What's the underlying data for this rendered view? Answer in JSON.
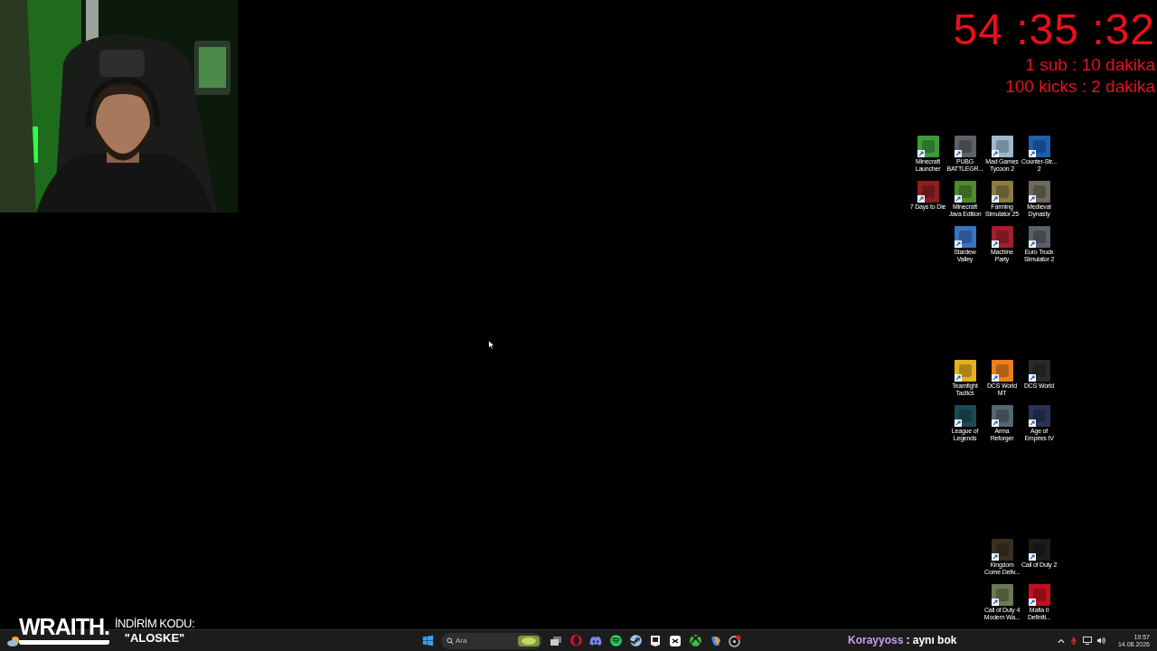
{
  "timer": {
    "time": "54 :35 :32",
    "rules": [
      "1 sub : 10 dakika",
      "100 kicks : 2 dakika"
    ]
  },
  "desktop_icon_groups": [
    {
      "rows": [
        [
          {
            "label": "Minecraft\nLauncher",
            "color": "#3c9b3a"
          },
          {
            "label": "PUBG\nBATTLEGR...",
            "color": "#5e6266"
          },
          {
            "label": "Mad Games\nTycoon 2",
            "color": "#9fb9cc"
          },
          {
            "label": "Counter-Str...\n2",
            "color": "#1f5fb0"
          }
        ],
        [
          {
            "label": "7 Days to Die",
            "color": "#8c1e1e"
          },
          {
            "label": "Minecraft\nJava Edition",
            "color": "#4f8a2c"
          },
          {
            "label": "Farming\nSimulator 25",
            "color": "#8a7b44"
          },
          {
            "label": "Medieval\nDynasty",
            "color": "#6d6a5c"
          }
        ],
        [
          "",
          {
            "label": "Stardew\nValley",
            "color": "#3a72c4"
          },
          {
            "label": "Machine\nParty",
            "color": "#a2202e"
          },
          {
            "label": "Euro Truck\nSimulator 2",
            "color": "#5a6068"
          }
        ]
      ]
    },
    {
      "rows": [
        [
          "",
          {
            "label": "Teamfight\nTactics",
            "color": "#e2b220"
          },
          {
            "label": "DCS World\nMT",
            "color": "#e8801c"
          },
          {
            "label": "DCS World",
            "color": "#2c2a26"
          }
        ],
        [
          "",
          {
            "label": "League of\nLegends",
            "color": "#1b4b52"
          },
          {
            "label": "Arma\nReforger",
            "color": "#56666e"
          },
          {
            "label": "Age of\nEmpires IV",
            "color": "#2a3254"
          }
        ]
      ]
    },
    {
      "rows": [
        [
          "",
          "",
          {
            "label": "Kingdom\nCome Deliv...",
            "color": "#3b3020"
          },
          {
            "label": "Call of Duty 2",
            "color": "#1c1c1a"
          }
        ],
        [
          "",
          "",
          {
            "label": "Call of Duty 4\nModern Wa...",
            "color": "#6b7a52"
          },
          {
            "label": "Mafia II\nDefiniti...",
            "color": "#c2101e"
          }
        ]
      ]
    }
  ],
  "sponsor_overlay": {
    "brand": "WRAITH.",
    "promo_label": "İNDİRİM KODU:",
    "promo_code": "\"ALOSKE\""
  },
  "taskbar": {
    "search": {
      "placeholder": "Ara"
    },
    "chat_overlay": {
      "user": "Korayyoss",
      "message": ": aynı bok"
    },
    "clock": {
      "time": "19:57",
      "date": "14.08.2026"
    }
  }
}
